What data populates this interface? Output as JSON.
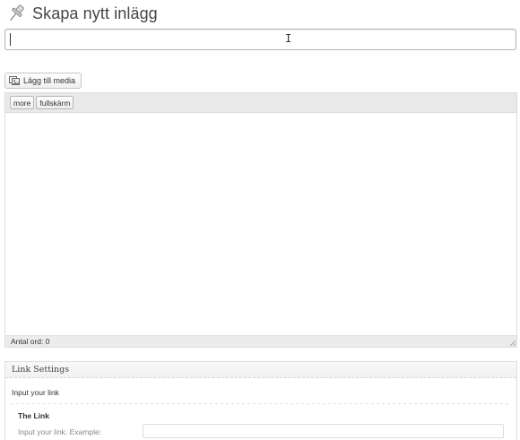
{
  "header": {
    "title": "Skapa nytt inlägg",
    "icon": "pushpin-icon"
  },
  "title_field": {
    "value": "",
    "placeholder": ""
  },
  "media_button": {
    "label": "Lägg till media",
    "icon": "media-icon"
  },
  "editor": {
    "toolbar": [
      {
        "label": "more"
      },
      {
        "label": "fullskärm"
      }
    ],
    "content": "",
    "word_count": "Antal ord: 0"
  },
  "link_settings": {
    "title": "Link Settings",
    "section_label": "Input your link",
    "field_name": "The Link",
    "field_description": "Input your link. Example:",
    "field_value": ""
  }
}
